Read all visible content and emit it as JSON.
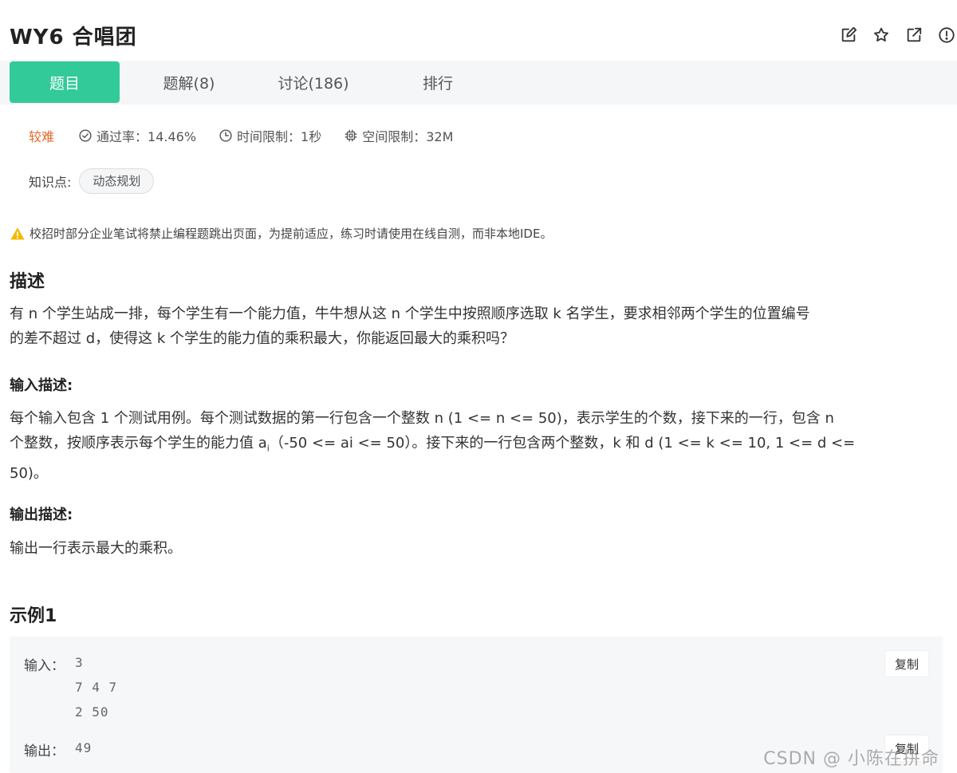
{
  "header": {
    "title": "WY6  合唱团",
    "icons": [
      "edit-icon",
      "star-icon",
      "external-link-icon",
      "info-icon"
    ]
  },
  "tabs": [
    {
      "label": "题目",
      "active": true
    },
    {
      "label": "题解(8)",
      "active": false
    },
    {
      "label": "讨论(186)",
      "active": false
    },
    {
      "label": "排行",
      "active": false
    }
  ],
  "meta": {
    "difficulty": "较难",
    "pass_rate": "通过率：14.46%",
    "time_limit": "时间限制：1秒",
    "space_limit": "空间限制：32M"
  },
  "knowledge": {
    "label": "知识点:",
    "tags": [
      "动态规划"
    ]
  },
  "notice": "校招时部分企业笔试将禁止编程题跳出页面，为提前适应，练习时请使用在线自测，而非本地IDE。",
  "description": {
    "title": "描述",
    "line1": "有 n 个学生站成一排，每个学生有一个能力值，牛牛想从这 n 个学生中按照顺序选取 k 名学生，要求相邻两个学生的位置编号",
    "line2": "的差不超过 d，使得这 k 个学生的能力值的乘积最大，你能返回最大的乘积吗？"
  },
  "input_desc": {
    "title": "输入描述:",
    "line1": "每个输入包含 1 个测试用例。每个测试数据的第一行包含一个整数 n (1 <= n <= 50)，表示学生的个数，接下来的一行，包含 n",
    "line2a": "个整数，按顺序表示每个学生的能力值 a",
    "line2sub": "i",
    "line2b": "（-50 <= ai <= 50）。接下来的一行包含两个整数，k 和 d (1 <= k <= 10, 1 <= d <=",
    "line3": "50)。"
  },
  "output_desc": {
    "title": "输出描述:",
    "text": "输出一行表示最大的乘积。"
  },
  "example": {
    "title": "示例1",
    "input_label": "输入：",
    "input_lines": [
      "3",
      "7 4 7",
      "2 50"
    ],
    "output_label": "输出：",
    "output_value": "49",
    "copy_label": "复制"
  },
  "watermark": "CSDN @ 小陈在拼命",
  "colors": {
    "accent": "#32ca99",
    "difficulty": "#e26b2b",
    "warning": "#f5b800"
  }
}
